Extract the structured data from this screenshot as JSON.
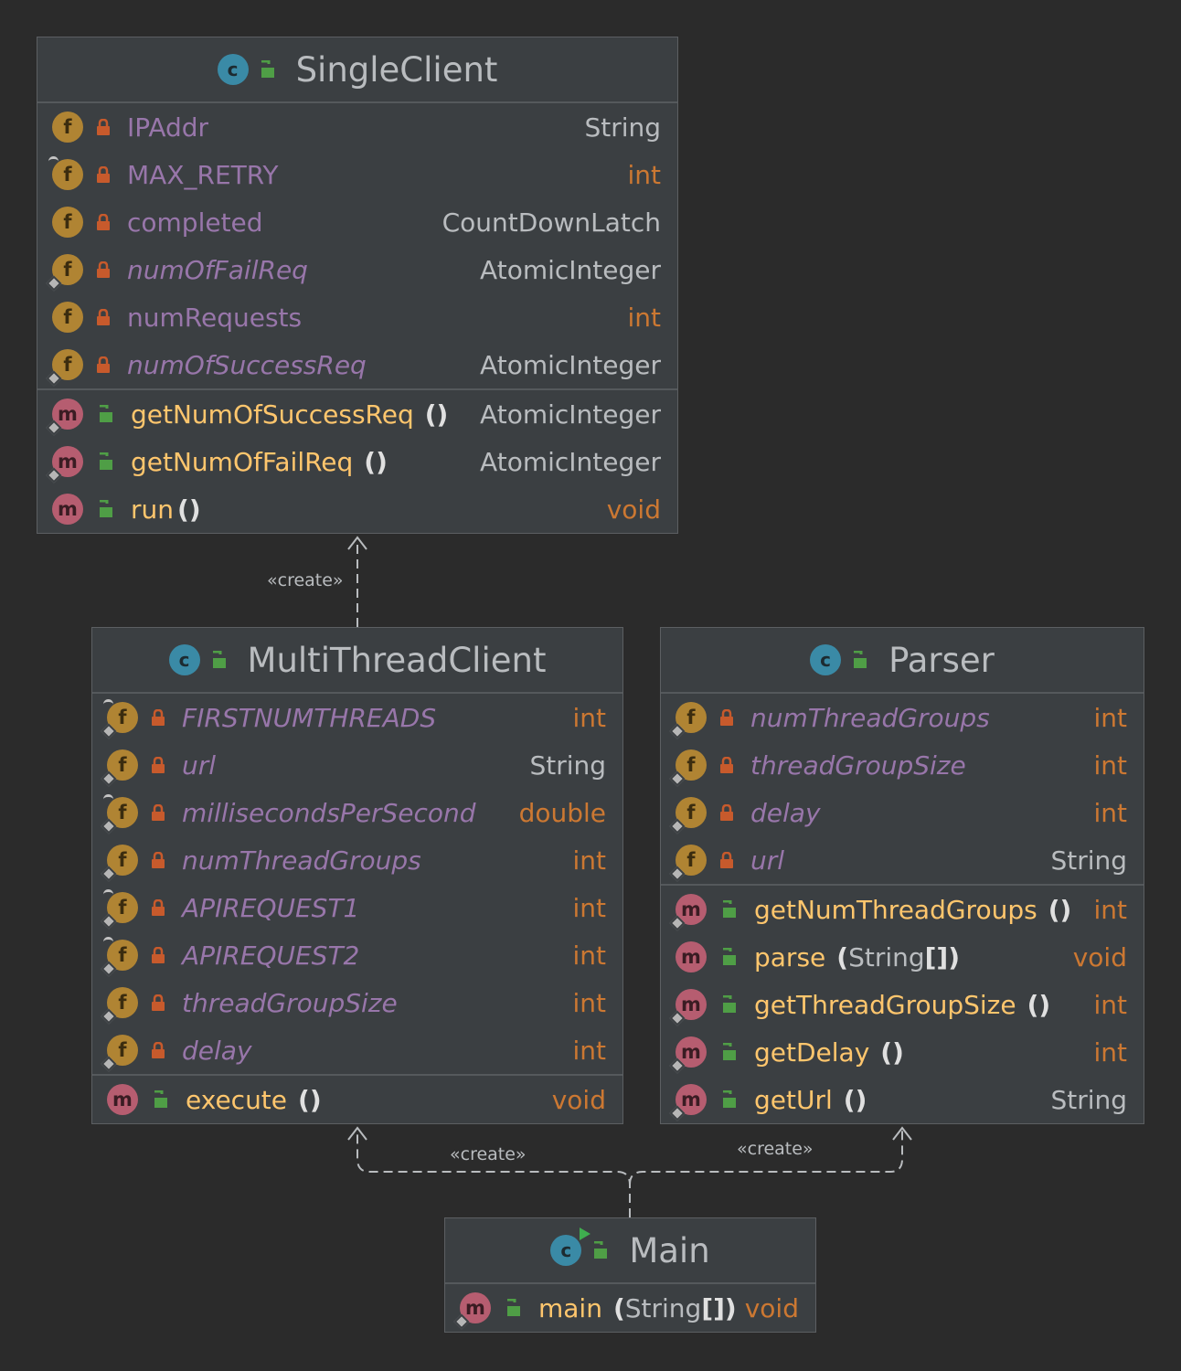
{
  "classes": {
    "single_client": {
      "name": "SingleClient",
      "fields": [
        {
          "name": "IPAddr",
          "type": "String"
        },
        {
          "name": "MAX_RETRY",
          "type": "int"
        },
        {
          "name": "completed",
          "type": "CountDownLatch"
        },
        {
          "name": "numOfFailReq",
          "type": "AtomicInteger"
        },
        {
          "name": "numRequests",
          "type": "int"
        },
        {
          "name": "numOfSuccessReq",
          "type": "AtomicInteger"
        }
      ],
      "methods": [
        {
          "name": "getNumOfSuccessReq",
          "params": "()",
          "type": "AtomicInteger"
        },
        {
          "name": "getNumOfFailReq",
          "params": "()",
          "type": "AtomicInteger"
        },
        {
          "name": "run",
          "params": "()",
          "type": "void"
        }
      ]
    },
    "multi_thread_client": {
      "name": "MultiThreadClient",
      "fields": [
        {
          "name": "FIRSTNUMTHREADS",
          "type": "int"
        },
        {
          "name": "url",
          "type": "String"
        },
        {
          "name": "millisecondsPerSecond",
          "type": "double"
        },
        {
          "name": "numThreadGroups",
          "type": "int"
        },
        {
          "name": "APIREQUEST1",
          "type": "int"
        },
        {
          "name": "APIREQUEST2",
          "type": "int"
        },
        {
          "name": "threadGroupSize",
          "type": "int"
        },
        {
          "name": "delay",
          "type": "int"
        }
      ],
      "methods": [
        {
          "name": "execute",
          "params": "()",
          "type": "void"
        }
      ]
    },
    "parser": {
      "name": "Parser",
      "fields": [
        {
          "name": "numThreadGroups",
          "type": "int"
        },
        {
          "name": "threadGroupSize",
          "type": "int"
        },
        {
          "name": "delay",
          "type": "int"
        },
        {
          "name": "url",
          "type": "String"
        }
      ],
      "methods": [
        {
          "name": "getNumThreadGroups",
          "params": "()",
          "type": "int"
        },
        {
          "name": "parse",
          "params_open": "(",
          "param_type": "String",
          "params_close": "[])",
          "type": "void"
        },
        {
          "name": "getThreadGroupSize",
          "params": "()",
          "type": "int"
        },
        {
          "name": "getDelay",
          "params": "()",
          "type": "int"
        },
        {
          "name": "getUrl",
          "params": "()",
          "type": "String"
        }
      ]
    },
    "main": {
      "name": "Main",
      "methods": [
        {
          "name": "main",
          "params_open": "(",
          "param_type": "String",
          "params_close": "[])",
          "type": "void"
        }
      ]
    }
  },
  "edges": [
    {
      "from": "MultiThreadClient",
      "to": "SingleClient",
      "label": "«create»"
    },
    {
      "from": "Main",
      "to": "MultiThreadClient",
      "label": "«create»"
    },
    {
      "from": "Main",
      "to": "Parser",
      "label": "«create»"
    }
  ],
  "icons": {
    "class_letter": "c",
    "field_letter": "f",
    "method_letter": "m"
  },
  "colors": {
    "background": "#2b2b2b",
    "box": "#3b3f42",
    "field_name": "#9876aa",
    "method_name": "#ffc66d",
    "primitive_type": "#cc7832",
    "reference_type": "#b9bcbf",
    "private_lock": "#c75a2c",
    "public_lock": "#4f9e46"
  }
}
